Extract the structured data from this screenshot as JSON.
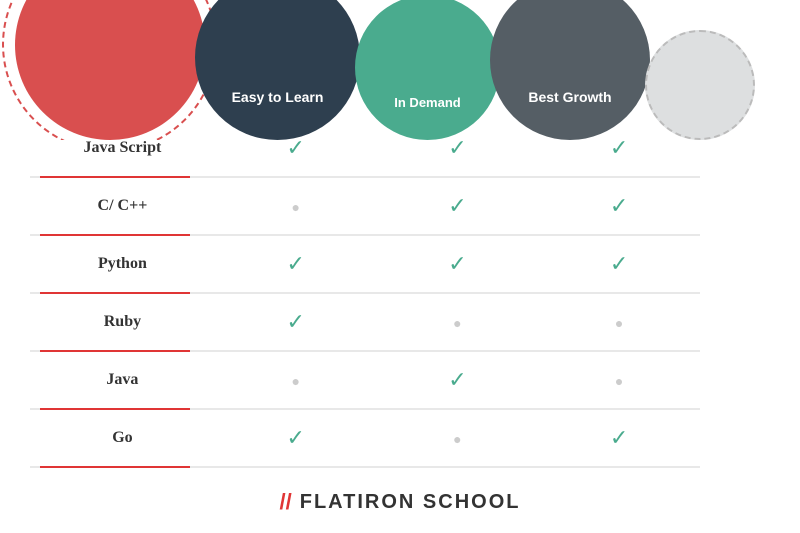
{
  "header": {
    "col1": "",
    "col2": "Easy to Learn",
    "col3": "In Demand",
    "col4": "Best Growth"
  },
  "rows": [
    {
      "lang": "Java Script",
      "easy": true,
      "demand": true,
      "growth": true
    },
    {
      "lang": "C/ C++",
      "easy": false,
      "demand": true,
      "growth": true
    },
    {
      "lang": "Python",
      "easy": true,
      "demand": true,
      "growth": true
    },
    {
      "lang": "Ruby",
      "easy": true,
      "demand": false,
      "growth": false
    },
    {
      "lang": "Java",
      "easy": false,
      "demand": true,
      "growth": false
    },
    {
      "lang": "Go",
      "easy": true,
      "demand": false,
      "growth": true
    }
  ],
  "footer": {
    "slashes": "//",
    "brand": "FLATIRON SCHOOL"
  },
  "colors": {
    "red": "#d94f4f",
    "teal": "#4aab8e",
    "dark": "#2e3f4f",
    "gray": "#555e65",
    "light": "#dddfe0",
    "accent_red": "#e03535"
  }
}
